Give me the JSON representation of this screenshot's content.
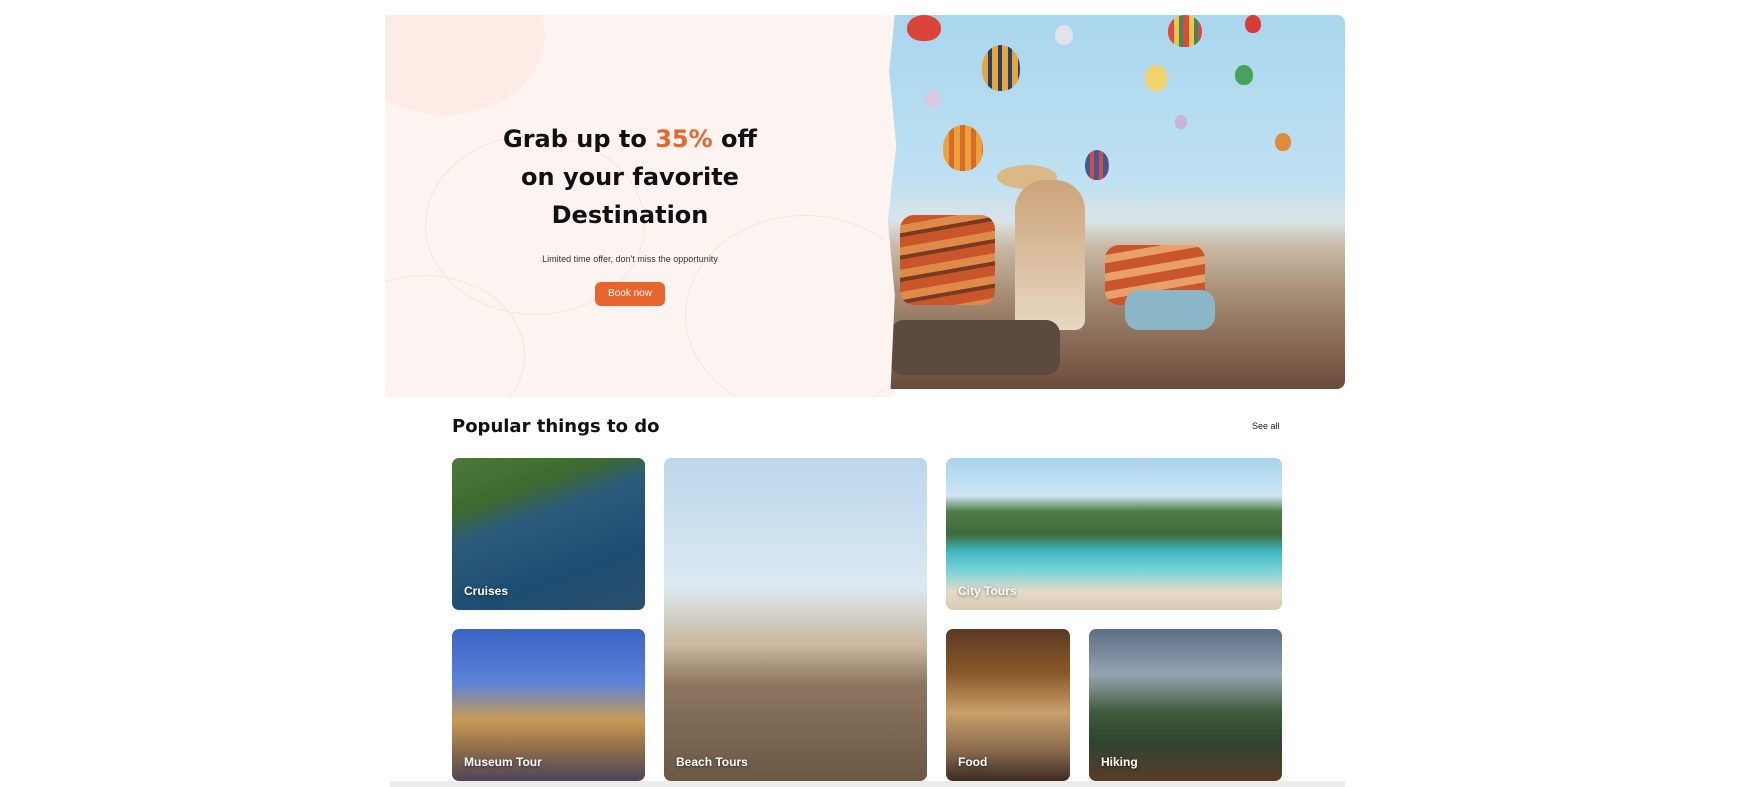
{
  "hero": {
    "title_line1_pre": "Grab up to ",
    "title_accent": "35%",
    "title_line1_post": " off",
    "title_line2": "on your favorite",
    "title_line3": "Destination",
    "subtitle": "Limited time offer, don't miss the opportunity",
    "cta_label": "Book now",
    "accent_color": "#e8652e"
  },
  "popular": {
    "title": "Popular things to do",
    "see_all": "See all",
    "cards": [
      {
        "label": "Cruises"
      },
      {
        "label": "Beach Tours"
      },
      {
        "label": "City Tours"
      },
      {
        "label": "Museum Tour"
      },
      {
        "label": "Food"
      },
      {
        "label": "Hiking"
      }
    ]
  }
}
